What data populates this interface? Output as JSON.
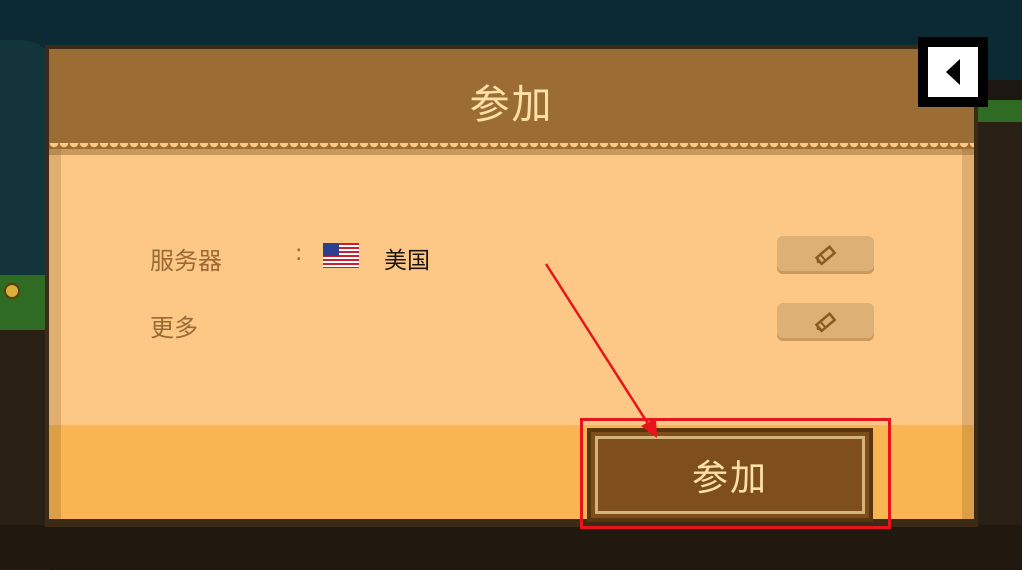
{
  "dialog": {
    "title": "参加"
  },
  "rows": [
    {
      "label": "服务器",
      "separator": ":",
      "value": "美国",
      "flag": "us-flag-icon",
      "edit_icon": "pencil-icon"
    },
    {
      "label": "更多",
      "edit_icon": "pencil-icon"
    }
  ],
  "join_button": {
    "label": "参加"
  },
  "back_button": {
    "icon": "back-arrow-icon"
  },
  "annotation": {
    "color": "#e8141c",
    "type": "arrow-and-box"
  },
  "colors": {
    "header": "#9b6d35",
    "body": "#fdc886",
    "footer": "#f8b551",
    "button": "#7e4f1d",
    "title_text": "#ffe0a6"
  }
}
